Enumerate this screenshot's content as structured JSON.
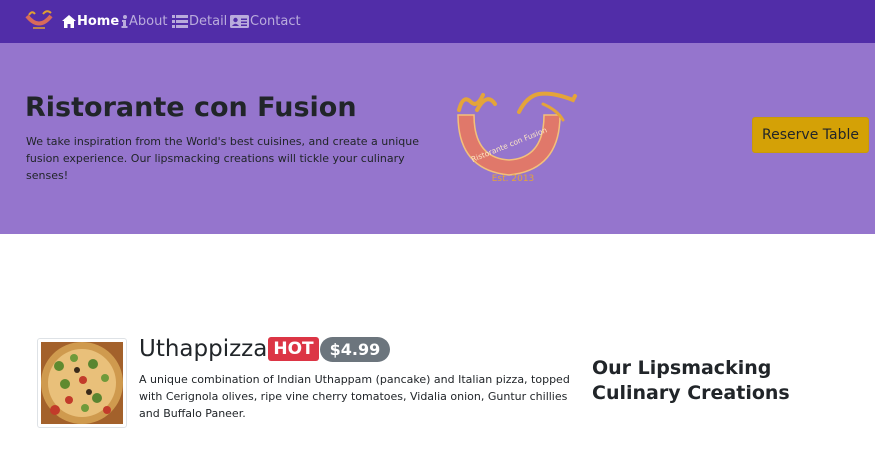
{
  "navbar": {
    "items": [
      {
        "label": "Home",
        "icon": "home-icon",
        "active": true
      },
      {
        "label": "About",
        "icon": "info-icon",
        "active": false
      },
      {
        "label": "Detail",
        "icon": "list-icon",
        "active": false
      },
      {
        "label": "Contact",
        "icon": "address-card-icon",
        "active": false
      }
    ],
    "colors": {
      "background": "#512da8",
      "active_text": "#ffffff",
      "inactive_text": "rgba(255,255,255,0.6)"
    }
  },
  "jumbotron": {
    "title": "Ristorante con Fusion",
    "text": "We take inspiration from the World's best cuisines, and create a unique fusion experience. Our lipsmacking creations will tickle your culinary senses!",
    "logo_text": "Ristorante con Fusion",
    "logo_est": "Est. 2013",
    "reserve_label": "Reserve Table",
    "colors": {
      "background": "#9575cd",
      "button": "#d4a106"
    }
  },
  "dish": {
    "name": "Uthappizza",
    "badge": "HOT",
    "price": "$4.99",
    "description": "A unique combination of Indian Uthappam (pancake) and Italian pizza, topped with Cerignola olives, ripe vine cherry tomatoes, Vidalia onion, Guntur chillies and Buffalo Paneer.",
    "colors": {
      "badge_hot": "#dc3545",
      "badge_price": "#6c757d"
    }
  },
  "side": {
    "heading": "Our Lipsmacking Culinary Creations"
  }
}
